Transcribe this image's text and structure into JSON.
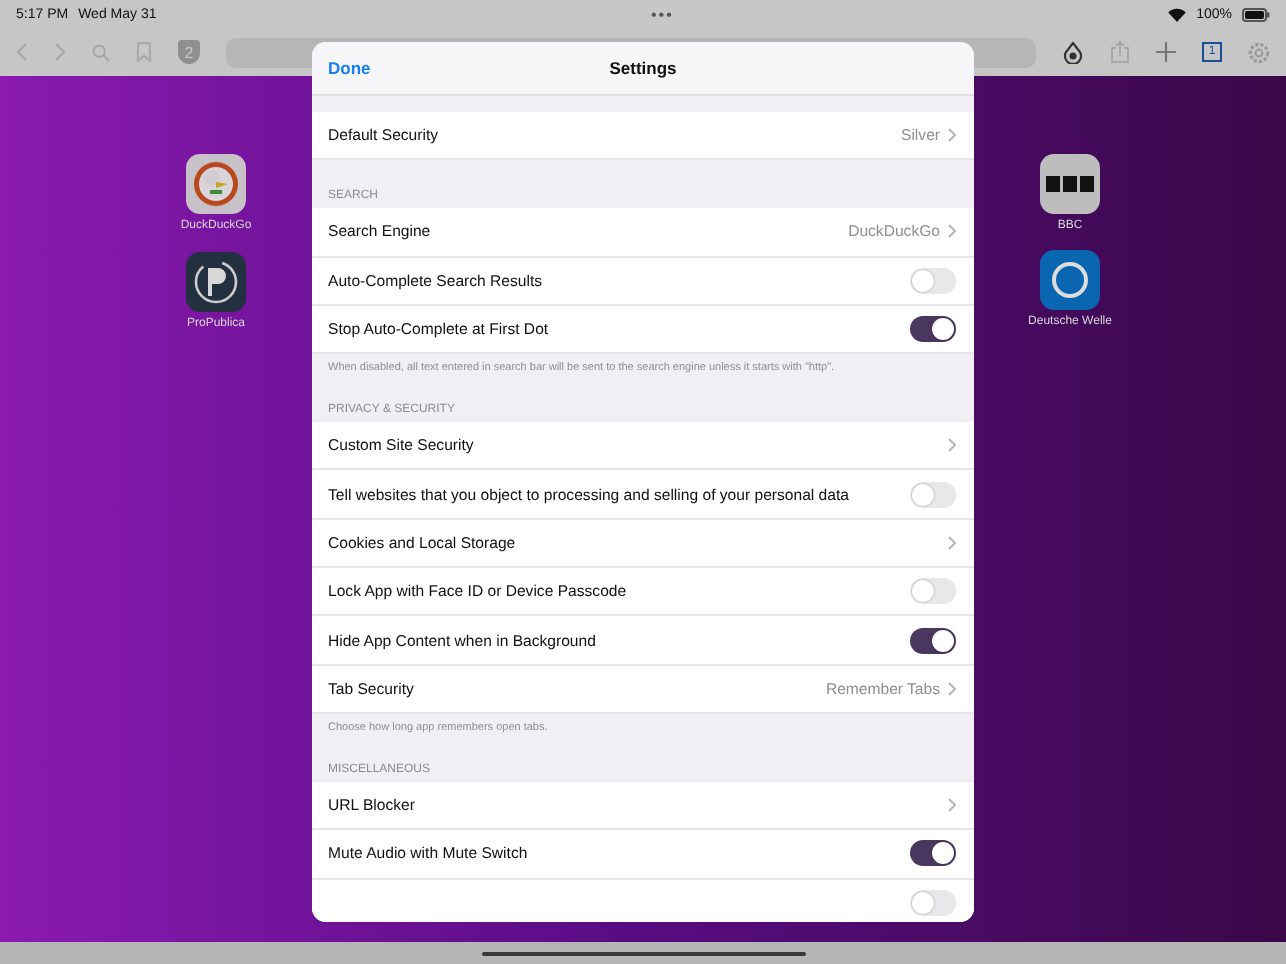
{
  "status_bar": {
    "time": "5:17 PM",
    "date": "Wed May 31",
    "dots": "•••",
    "battery": "100%"
  },
  "toolbar": {
    "shield_count": "2",
    "tab_count": "1"
  },
  "home_icons": [
    {
      "label": "DuckDuckGo",
      "kind": "duck"
    },
    {
      "label": "BBC",
      "kind": "bbc"
    },
    {
      "label": "ProPublica",
      "kind": "propublica"
    },
    {
      "label": "Deutsche Welle",
      "kind": "dw"
    }
  ],
  "settings": {
    "done": "Done",
    "title": "Settings",
    "sections": [
      {
        "rows": [
          {
            "kind": "value",
            "label": "Default Security",
            "value": "Silver"
          }
        ]
      },
      {
        "header": "SEARCH",
        "rows": [
          {
            "kind": "value",
            "label": "Search Engine",
            "value": "DuckDuckGo"
          },
          {
            "kind": "toggle",
            "label": "Auto-Complete Search Results",
            "on": false
          },
          {
            "kind": "toggle",
            "label": "Stop Auto-Complete at First Dot",
            "on": true
          }
        ],
        "footer": "When disabled, all text entered in search bar will be sent to the search engine unless it starts with \"http\"."
      },
      {
        "header": "PRIVACY & SECURITY",
        "rows": [
          {
            "kind": "chevron",
            "label": "Custom Site Security"
          },
          {
            "kind": "toggle",
            "label": "Tell websites that you object to processing and selling of your personal data",
            "on": false
          },
          {
            "kind": "chevron",
            "label": "Cookies and Local Storage"
          },
          {
            "kind": "toggle",
            "label": "Lock App with Face ID or Device Passcode",
            "on": false
          },
          {
            "kind": "toggle",
            "label": "Hide App Content when in Background",
            "on": true
          },
          {
            "kind": "value",
            "label": "Tab Security",
            "value": "Remember Tabs"
          }
        ],
        "footer": "Choose how long app remembers open tabs."
      },
      {
        "header": "MISCELLANEOUS",
        "rows": [
          {
            "kind": "chevron",
            "label": "URL Blocker"
          },
          {
            "kind": "toggle",
            "label": "Mute Audio with Mute Switch",
            "on": true
          },
          {
            "kind": "toggle",
            "on": false
          }
        ]
      }
    ]
  }
}
